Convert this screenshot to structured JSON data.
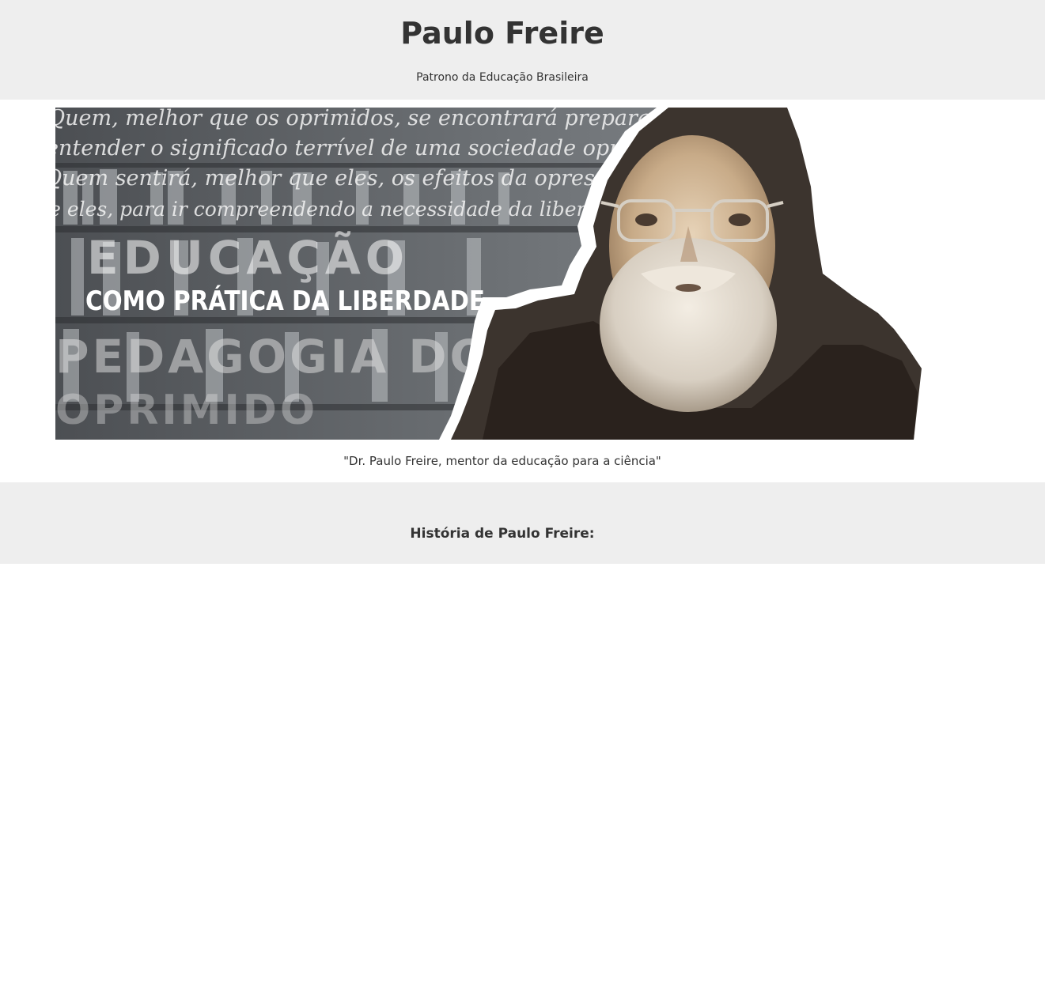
{
  "header": {
    "title": "Paulo Freire",
    "subtitle": "Patrono da Educação Brasileira"
  },
  "hero": {
    "overlay_lines": [
      "Quem, melhor que os oprimidos, se encontrará preparado para",
      "entender o significado terrível de uma sociedade opressora?",
      "Quem sentirá, melhor que eles, os efeitos da opressão? Quem,",
      "que eles, para ir compreendendo a necessidade da libertação"
    ],
    "book_1_title": "EDUCAÇÃO",
    "book_1_subtitle": "COMO PRÁTICA DA LIBERDADE",
    "book_2_title": "PEDAGOGIA DO",
    "book_2_subtitle": "OPRIMIDO"
  },
  "caption": "\"Dr. Paulo Freire, mentor da educação para a ciência\"",
  "history": {
    "title": "História de Paulo Freire:"
  }
}
